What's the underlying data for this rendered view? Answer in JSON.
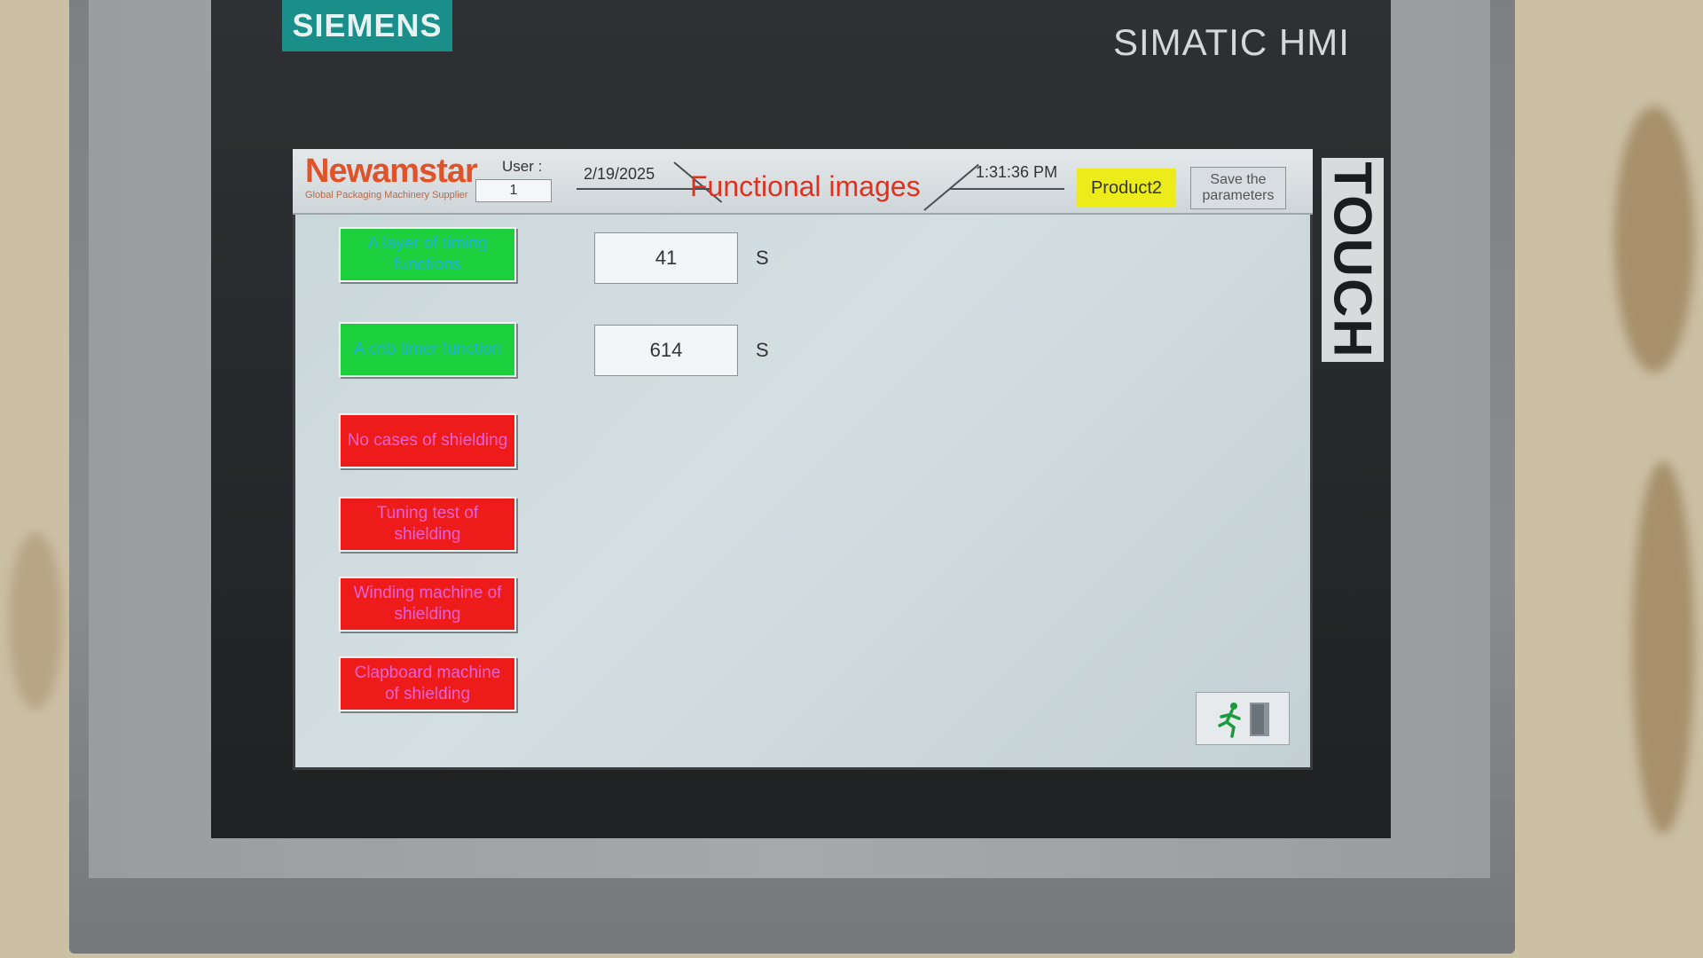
{
  "device": {
    "brand": "SIEMENS",
    "model": "SIMATIC HMI",
    "touch_label": "TOUCH"
  },
  "header": {
    "logo": "Newamstar",
    "logo_subtitle": "Global Packaging Machinery Supplier",
    "user_label": "User :",
    "user_value": "1",
    "date": "2/19/2025",
    "title": "Functional images",
    "time": "1:31:36 PM",
    "product": "Product2",
    "save_button": "Save the parameters"
  },
  "functions": [
    {
      "label": "A layer of timing functions",
      "state": "green",
      "value": "41",
      "unit": "S"
    },
    {
      "label": "A crib timer function",
      "state": "green",
      "value": "614",
      "unit": "S"
    },
    {
      "label": "No cases of shielding",
      "state": "red"
    },
    {
      "label": "Tuning test of shielding",
      "state": "red"
    },
    {
      "label": "Winding machine of shielding",
      "state": "red"
    },
    {
      "label": "Clapboard machine of shielding",
      "state": "red"
    }
  ],
  "colors": {
    "green_button": "#1ccf3c",
    "red_button": "#ee1b1b",
    "title_red": "#e0301e",
    "product_yellow": "#ecec1a",
    "siemens_teal": "#1a8f8a"
  },
  "icons": {
    "exit": "exit-running-man-icon"
  }
}
